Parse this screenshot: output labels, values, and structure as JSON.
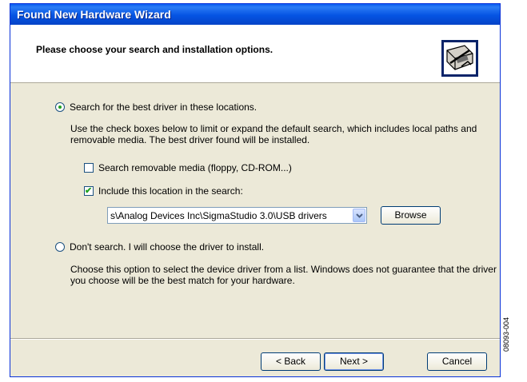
{
  "window": {
    "title": "Found New Hardware Wizard"
  },
  "header": {
    "title": "Please choose your search and installation options.",
    "icon": "hardware-icon"
  },
  "options": {
    "search_label": "Search for the best driver in these locations.",
    "search_selected": true,
    "search_description": "Use the check boxes below to limit or expand the default search, which includes local paths and removable media. The best driver found will be installed.",
    "removable_label": "Search removable media (floppy, CD-ROM...)",
    "removable_checked": false,
    "include_label": "Include this location in the search:",
    "include_checked": true,
    "location_value": "s\\Analog Devices Inc\\SigmaStudio 3.0\\USB drivers",
    "browse_label": "Browse",
    "dont_search_label": "Don't search. I will choose the driver to install.",
    "dont_search_selected": false,
    "dont_search_description": "Choose this option to select the device driver from a list.  Windows does not guarantee that the driver you choose will be the best match for your hardware."
  },
  "footer": {
    "back_label": "< Back",
    "next_label": "Next >",
    "cancel_label": "Cancel"
  },
  "figure_label": "08093-004"
}
